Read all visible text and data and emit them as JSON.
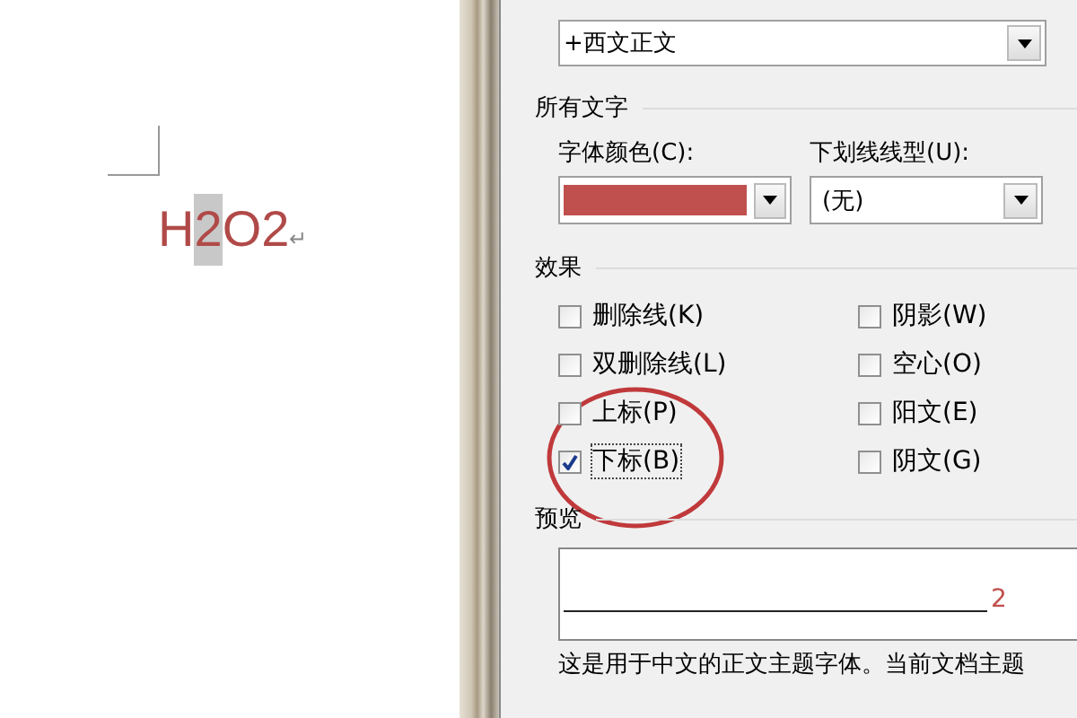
{
  "document": {
    "segments": [
      {
        "text": "H",
        "selected": false
      },
      {
        "text": "2",
        "selected": true
      },
      {
        "text": "O2",
        "selected": false
      }
    ],
    "paragraph_mark": "↵",
    "color": "#b04a48"
  },
  "dialog": {
    "latin_font": {
      "value": "+西文正文"
    },
    "all_text": {
      "heading": "所有文字",
      "font_color": {
        "label": "字体颜色(C):",
        "color": "#c0504d"
      },
      "underline": {
        "label": "下划线线型(U):",
        "value": "(无)"
      }
    },
    "effects": {
      "heading": "效果",
      "options": [
        {
          "label": "删除线(K)",
          "checked": false
        },
        {
          "label": "阴影(W)",
          "checked": false
        },
        {
          "label": "双删除线(L)",
          "checked": false
        },
        {
          "label": "空心(O)",
          "checked": false
        },
        {
          "label": "上标(P)",
          "checked": false
        },
        {
          "label": "阳文(E)",
          "checked": false
        },
        {
          "label": "下标(B)",
          "checked": true
        },
        {
          "label": "阴文(G)",
          "checked": false
        }
      ]
    },
    "preview": {
      "heading": "预览",
      "sample": "2",
      "description": "这是用于中文的正文主题字体。当前文档主题"
    }
  }
}
